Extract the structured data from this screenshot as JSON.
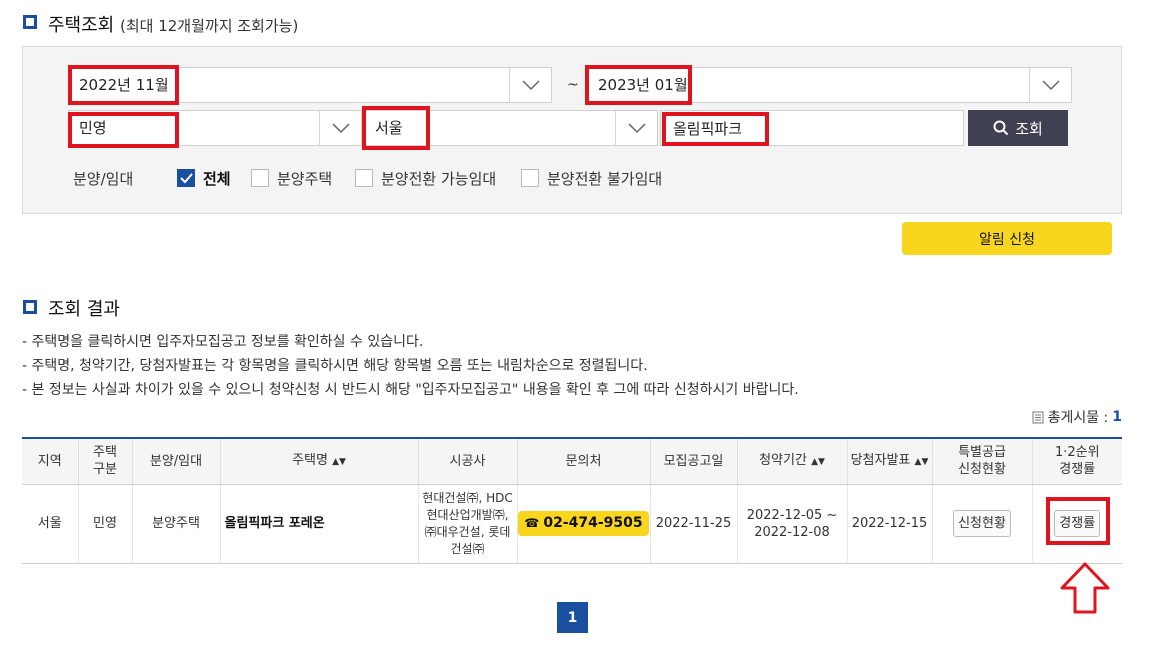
{
  "search_section": {
    "title": "주택조회",
    "subtitle": "(최대 12개월까지 조회가능)",
    "start_month": "2022년 11월",
    "range_separator": "~",
    "end_month": "2023년 01월",
    "house_type": "민영",
    "region": "서울",
    "keyword": "올림픽파크",
    "search_button": "조회",
    "filter_label": "분양/임대",
    "filters": [
      {
        "label": "전체",
        "checked": true
      },
      {
        "label": "분양주택",
        "checked": false
      },
      {
        "label": "분양전환 가능임대",
        "checked": false
      },
      {
        "label": "분양전환 불가임대",
        "checked": false
      }
    ],
    "alarm_button": "알림 신청"
  },
  "result_section": {
    "title": "조회 결과",
    "notes": [
      "-  주택명을 클릭하시면 입주자모집공고 정보를 확인하실 수 있습니다.",
      "-  주택명, 청약기간, 당첨자발표는 각 항목명을 클릭하시면 해당 항목별 오름 또는 내림차순으로 정렬됩니다.",
      "-  본 정보는 사실과 차이가 있을 수 있으니 청약신청 시 반드시 해당 \"입주자모집공고\" 내용을 확인 후 그에 따라 신청하시기 바랍니다."
    ],
    "total_label": "총게시물 :",
    "total_count": "1",
    "columns": {
      "region": "지역",
      "house_kind_1": "주택",
      "house_kind_2": "구분",
      "sale_rent": "분양/임대",
      "house_name": "주택명",
      "builder": "시공사",
      "contact": "문의처",
      "notice_date": "모집공고일",
      "period": "청약기간",
      "winner": "당첨자발표",
      "special_1": "특별공급",
      "special_2": "신청현황",
      "rank_1": "1·2순위",
      "rank_2": "경쟁률"
    },
    "rows": [
      {
        "region": "서울",
        "house_kind": "민영",
        "sale_rent": "분양주택",
        "house_name": "올림픽파크 포레온",
        "builder_1": "현대건설㈜, HDC",
        "builder_2": "현대산업개발㈜,",
        "builder_3": "㈜대우건설, 롯데",
        "builder_4": "건설㈜",
        "contact": "02-474-9505",
        "notice_date": "2022-11-25",
        "period_start": "2022-12-05 ~",
        "period_end": "2022-12-08",
        "winner_date": "2022-12-15",
        "special_button": "신청현황",
        "rank_button": "경쟁률"
      }
    ]
  },
  "pagination": {
    "current": "1"
  },
  "colors": {
    "accent": "#1a4fa0",
    "yellow": "#f9d61e",
    "highlight": "#e0141e",
    "search_button": "#3f4150"
  }
}
